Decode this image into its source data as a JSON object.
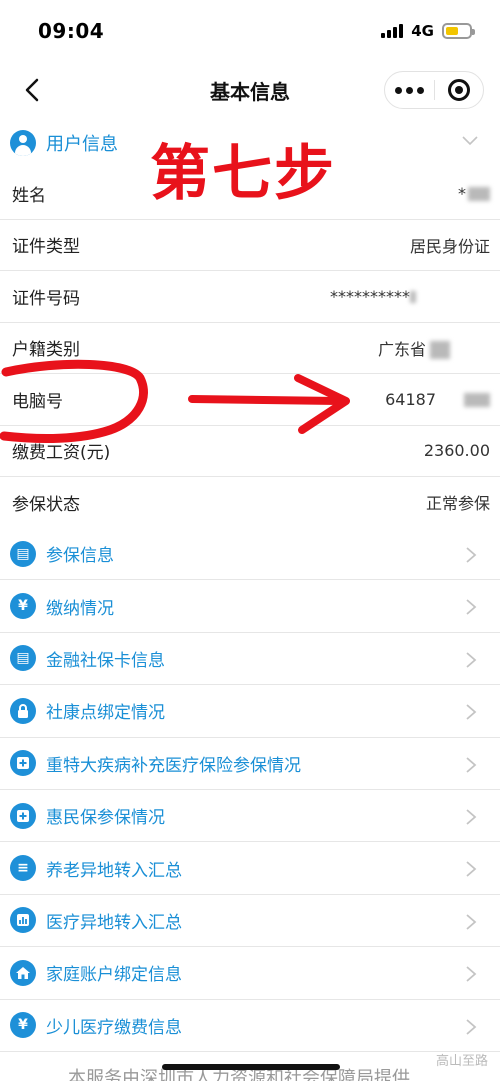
{
  "status_bar": {
    "time": "09:04",
    "network": "4G"
  },
  "nav": {
    "title": "基本信息"
  },
  "section": {
    "title": "用户信息"
  },
  "annotation": {
    "step_text": "第七步"
  },
  "info_rows": [
    {
      "label": "姓名",
      "value": "*"
    },
    {
      "label": "证件类型",
      "value": "居民身份证"
    },
    {
      "label": "证件号码",
      "value": "**********"
    },
    {
      "label": "户籍类别",
      "value": "广东省"
    },
    {
      "label": "电脑号",
      "value": "64187"
    },
    {
      "label": "缴费工资(元)",
      "value": "2360.00"
    },
    {
      "label": "参保状态",
      "value": "正常参保"
    }
  ],
  "menu_items": [
    {
      "label": "参保信息",
      "icon": "card-icon",
      "glyph": "▤"
    },
    {
      "label": "缴纳情况",
      "icon": "yen-icon",
      "glyph": "¥"
    },
    {
      "label": "金融社保卡信息",
      "icon": "card-icon",
      "glyph": "▤"
    },
    {
      "label": "社康点绑定情况",
      "icon": "lock-icon",
      "glyph": "🔒"
    },
    {
      "label": "重特大疾病补充医疗保险参保情况",
      "icon": "medical-plus-icon",
      "glyph": "+"
    },
    {
      "label": "惠民保参保情况",
      "icon": "medical-plus-icon",
      "glyph": "+"
    },
    {
      "label": "养老异地转入汇总",
      "icon": "document-icon",
      "glyph": "≡"
    },
    {
      "label": "医疗异地转入汇总",
      "icon": "chart-icon",
      "glyph": "▥"
    },
    {
      "label": "家庭账户绑定信息",
      "icon": "home-icon",
      "glyph": "⌂"
    },
    {
      "label": "少儿医疗缴费信息",
      "icon": "yen-icon",
      "glyph": "¥"
    }
  ],
  "footer": {
    "text": "本服务由深圳市人力资源和社会保障局提供"
  },
  "watermark": {
    "text": "高山至路"
  },
  "colors": {
    "accent": "#1a8fd6",
    "annotation": "#e8121b"
  }
}
